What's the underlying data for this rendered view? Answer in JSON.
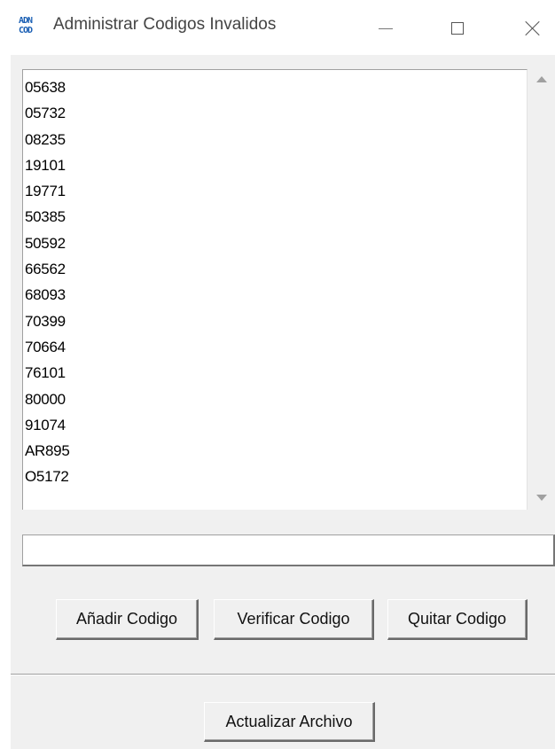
{
  "window": {
    "title": "Administrar Codigos Invalidos",
    "icon_text": [
      "ADN",
      "COD"
    ],
    "controls": [
      "minimize-icon",
      "maximize-icon",
      "close-icon"
    ]
  },
  "codes_list": {
    "items": [
      "05638",
      "05732",
      "08235",
      "19101",
      "19771",
      "50385",
      "50592",
      "66562",
      "68093",
      "70399",
      "70664",
      "76101",
      "80000",
      "91074",
      "AR895",
      "O5172"
    ]
  },
  "code_input": {
    "value": "",
    "placeholder": ""
  },
  "actions": {
    "add_label": "Añadir Codigo",
    "verify_label": "Verificar Codigo",
    "remove_label": "Quitar Codigo",
    "update_label": "Actualizar Archivo"
  }
}
